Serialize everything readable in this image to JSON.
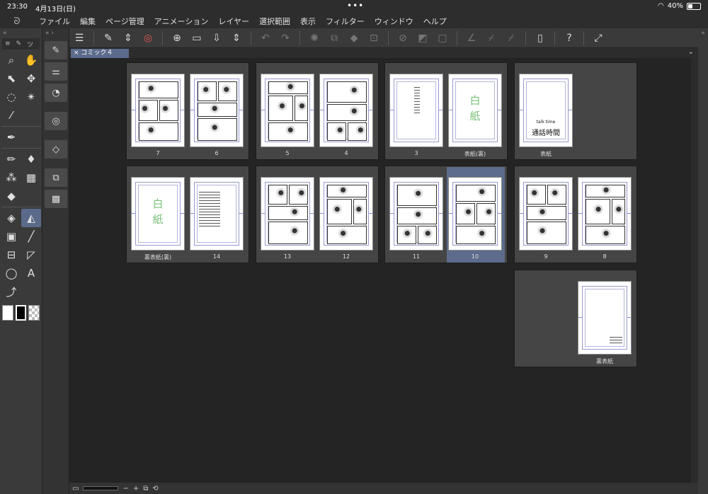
{
  "status": {
    "time": "23:30",
    "date": "4月13日(日)",
    "battery": "40%",
    "battery_level": 0.4
  },
  "menu": [
    "ファイル",
    "編集",
    "ページ管理",
    "アニメーション",
    "レイヤー",
    "選択範囲",
    "表示",
    "フィルター",
    "ウィンドウ",
    "ヘルプ"
  ],
  "tool_panel": {
    "header_short": "ツ"
  },
  "tab": {
    "title": "コミック４"
  },
  "pages": [
    {
      "label": "7",
      "kind": "manga"
    },
    {
      "label": "6",
      "kind": "manga"
    },
    {
      "label": "5",
      "kind": "manga"
    },
    {
      "label": "4",
      "kind": "manga"
    },
    {
      "label": "3",
      "kind": "text"
    },
    {
      "label": "表紙(裏)",
      "kind": "blank-mark"
    },
    {
      "label": "表紙",
      "kind": "cover"
    },
    {
      "label": "裏表紙(裏)",
      "kind": "blank-mark"
    },
    {
      "label": "14",
      "kind": "colophon"
    },
    {
      "label": "13",
      "kind": "manga"
    },
    {
      "label": "12",
      "kind": "manga"
    },
    {
      "label": "11",
      "kind": "manga"
    },
    {
      "label": "10",
      "kind": "manga"
    },
    {
      "label": "9",
      "kind": "manga"
    },
    {
      "label": "8",
      "kind": "manga"
    },
    {
      "label": "裏表紙",
      "kind": "back"
    }
  ],
  "marks": {
    "blank": "白\n紙",
    "cover_title": "通話時間",
    "cover_sub": "talk time"
  },
  "selected_page": "10"
}
